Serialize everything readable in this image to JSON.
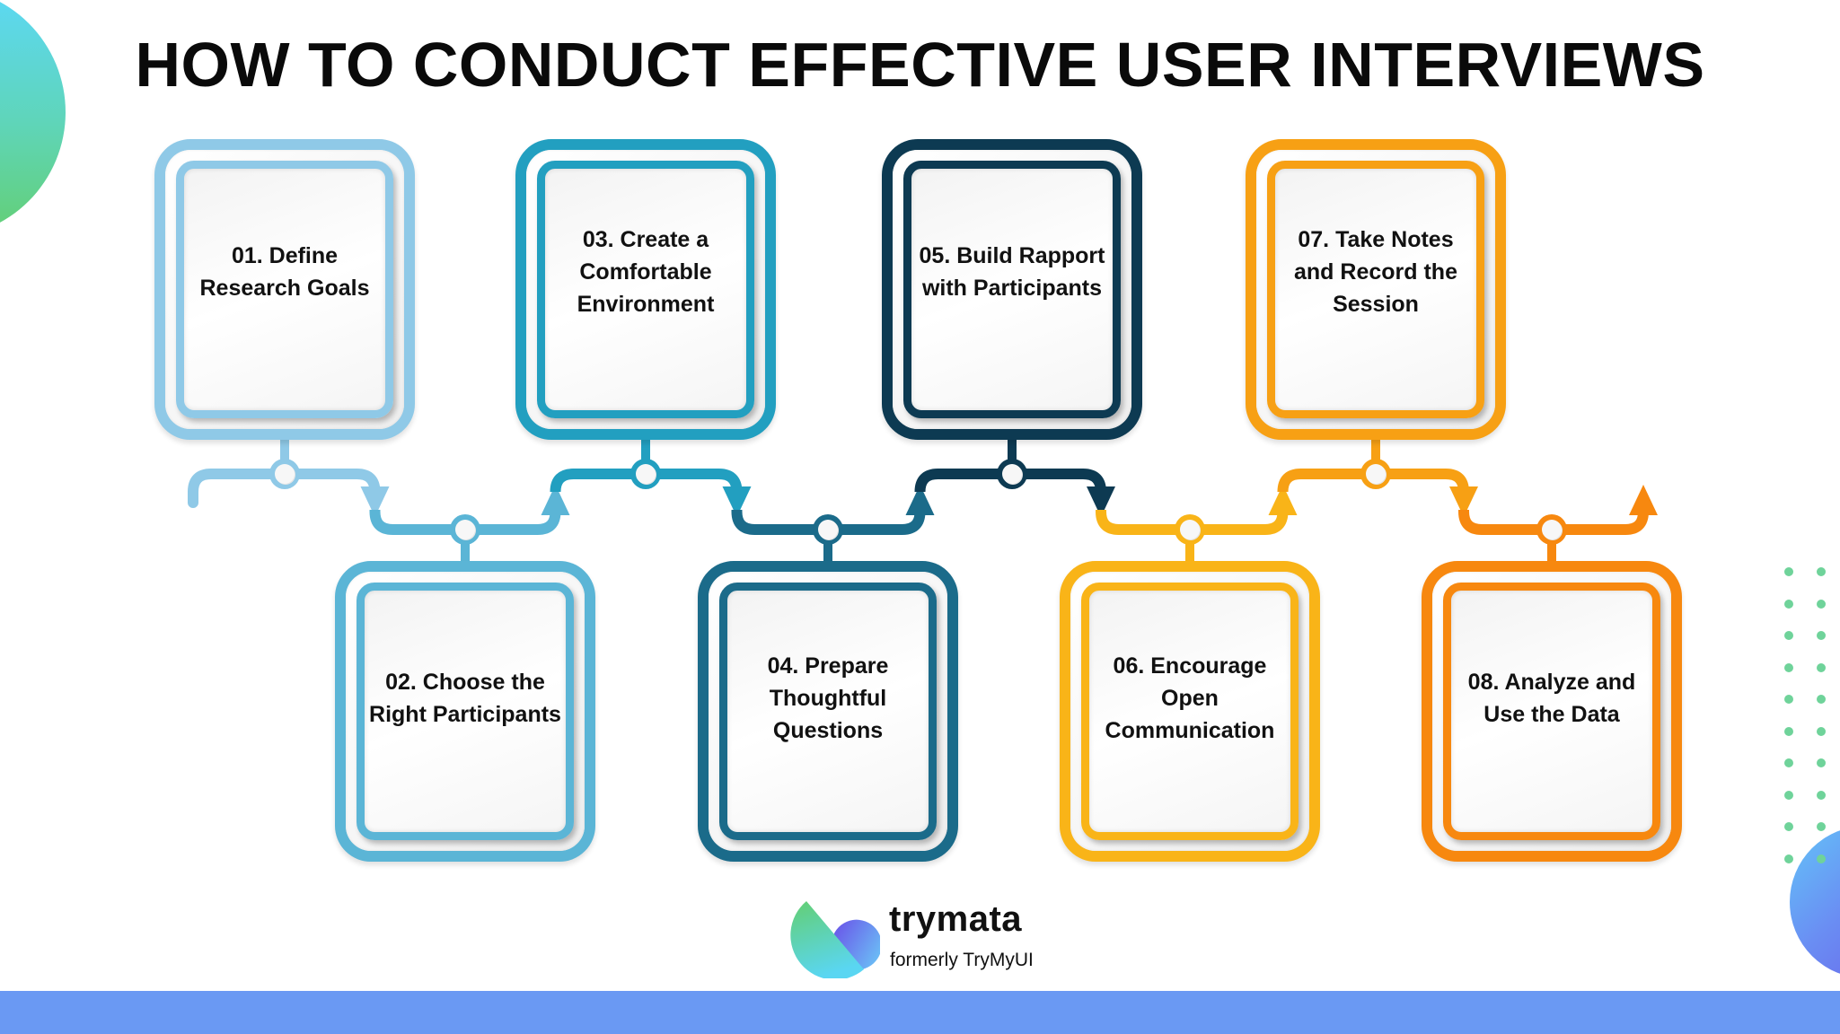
{
  "title": "HOW TO CONDUCT EFFECTIVE USER INTERVIEWS",
  "steps": [
    {
      "label": "01. Define Research Goals",
      "color": "#8fc9e7",
      "row": "top"
    },
    {
      "label": "02. Choose the Right Participants",
      "color": "#5bb5d6",
      "row": "bottom"
    },
    {
      "label": "03. Create a Comfortable Environment",
      "color": "#229fc0",
      "row": "top"
    },
    {
      "label": "04. Prepare Thoughtful Questions",
      "color": "#1b6b8a",
      "row": "bottom"
    },
    {
      "label": "05. Build Rapport with Participants",
      "color": "#0d3a52",
      "row": "top"
    },
    {
      "label": "06. Encourage Open Communication",
      "color": "#f9b418",
      "row": "bottom"
    },
    {
      "label": "07. Take Notes and Record the Session",
      "color": "#f7a014",
      "row": "top"
    },
    {
      "label": "08. Analyze and Use the Data",
      "color": "#f7880f",
      "row": "bottom"
    }
  ],
  "logo": {
    "name": "trymata",
    "subtitle": "formerly TryMyUI"
  },
  "decor": {
    "dot_color": "#6fd39a",
    "bar_color": "#6a99f3"
  }
}
